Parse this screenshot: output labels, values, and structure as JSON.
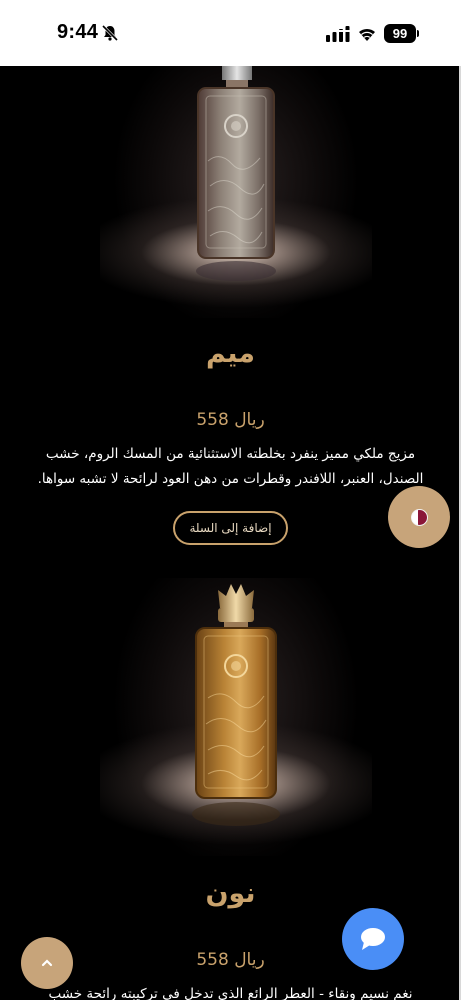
{
  "status_bar": {
    "time": "9:44",
    "battery": "99",
    "icons": [
      "bell-slash-icon",
      "signal-icon",
      "wifi-icon",
      "battery-icon"
    ]
  },
  "products": [
    {
      "image": "perfume-bottle-meem",
      "name": "ميم",
      "price": "558 ريال",
      "description": "مزيج ملكي مميز ينفرد بخلطته الاستثنائية من المسك الروم، خشب الصندل، العنبر، اللافندر وقطرات من دهن العود لرائحة لا تشبه سواها.",
      "add_to_cart": "إضافة إلى السلة"
    },
    {
      "image": "perfume-bottle-noon",
      "name": "نون",
      "price": "558 ريال",
      "description": "نغم نسيم ونقاء - العطر الرائع الذي تدخل في تركيبته رائحة خشب"
    }
  ],
  "floating": {
    "flag_icon": "qatar-flag-icon",
    "chat_icon": "chat-bubble-icon",
    "top_icon": "chevron-up-icon"
  },
  "colors": {
    "gold": "#c9a26c",
    "button_gold": "#c7a47a",
    "chat_blue": "#4a8ef6",
    "background": "#000000"
  }
}
